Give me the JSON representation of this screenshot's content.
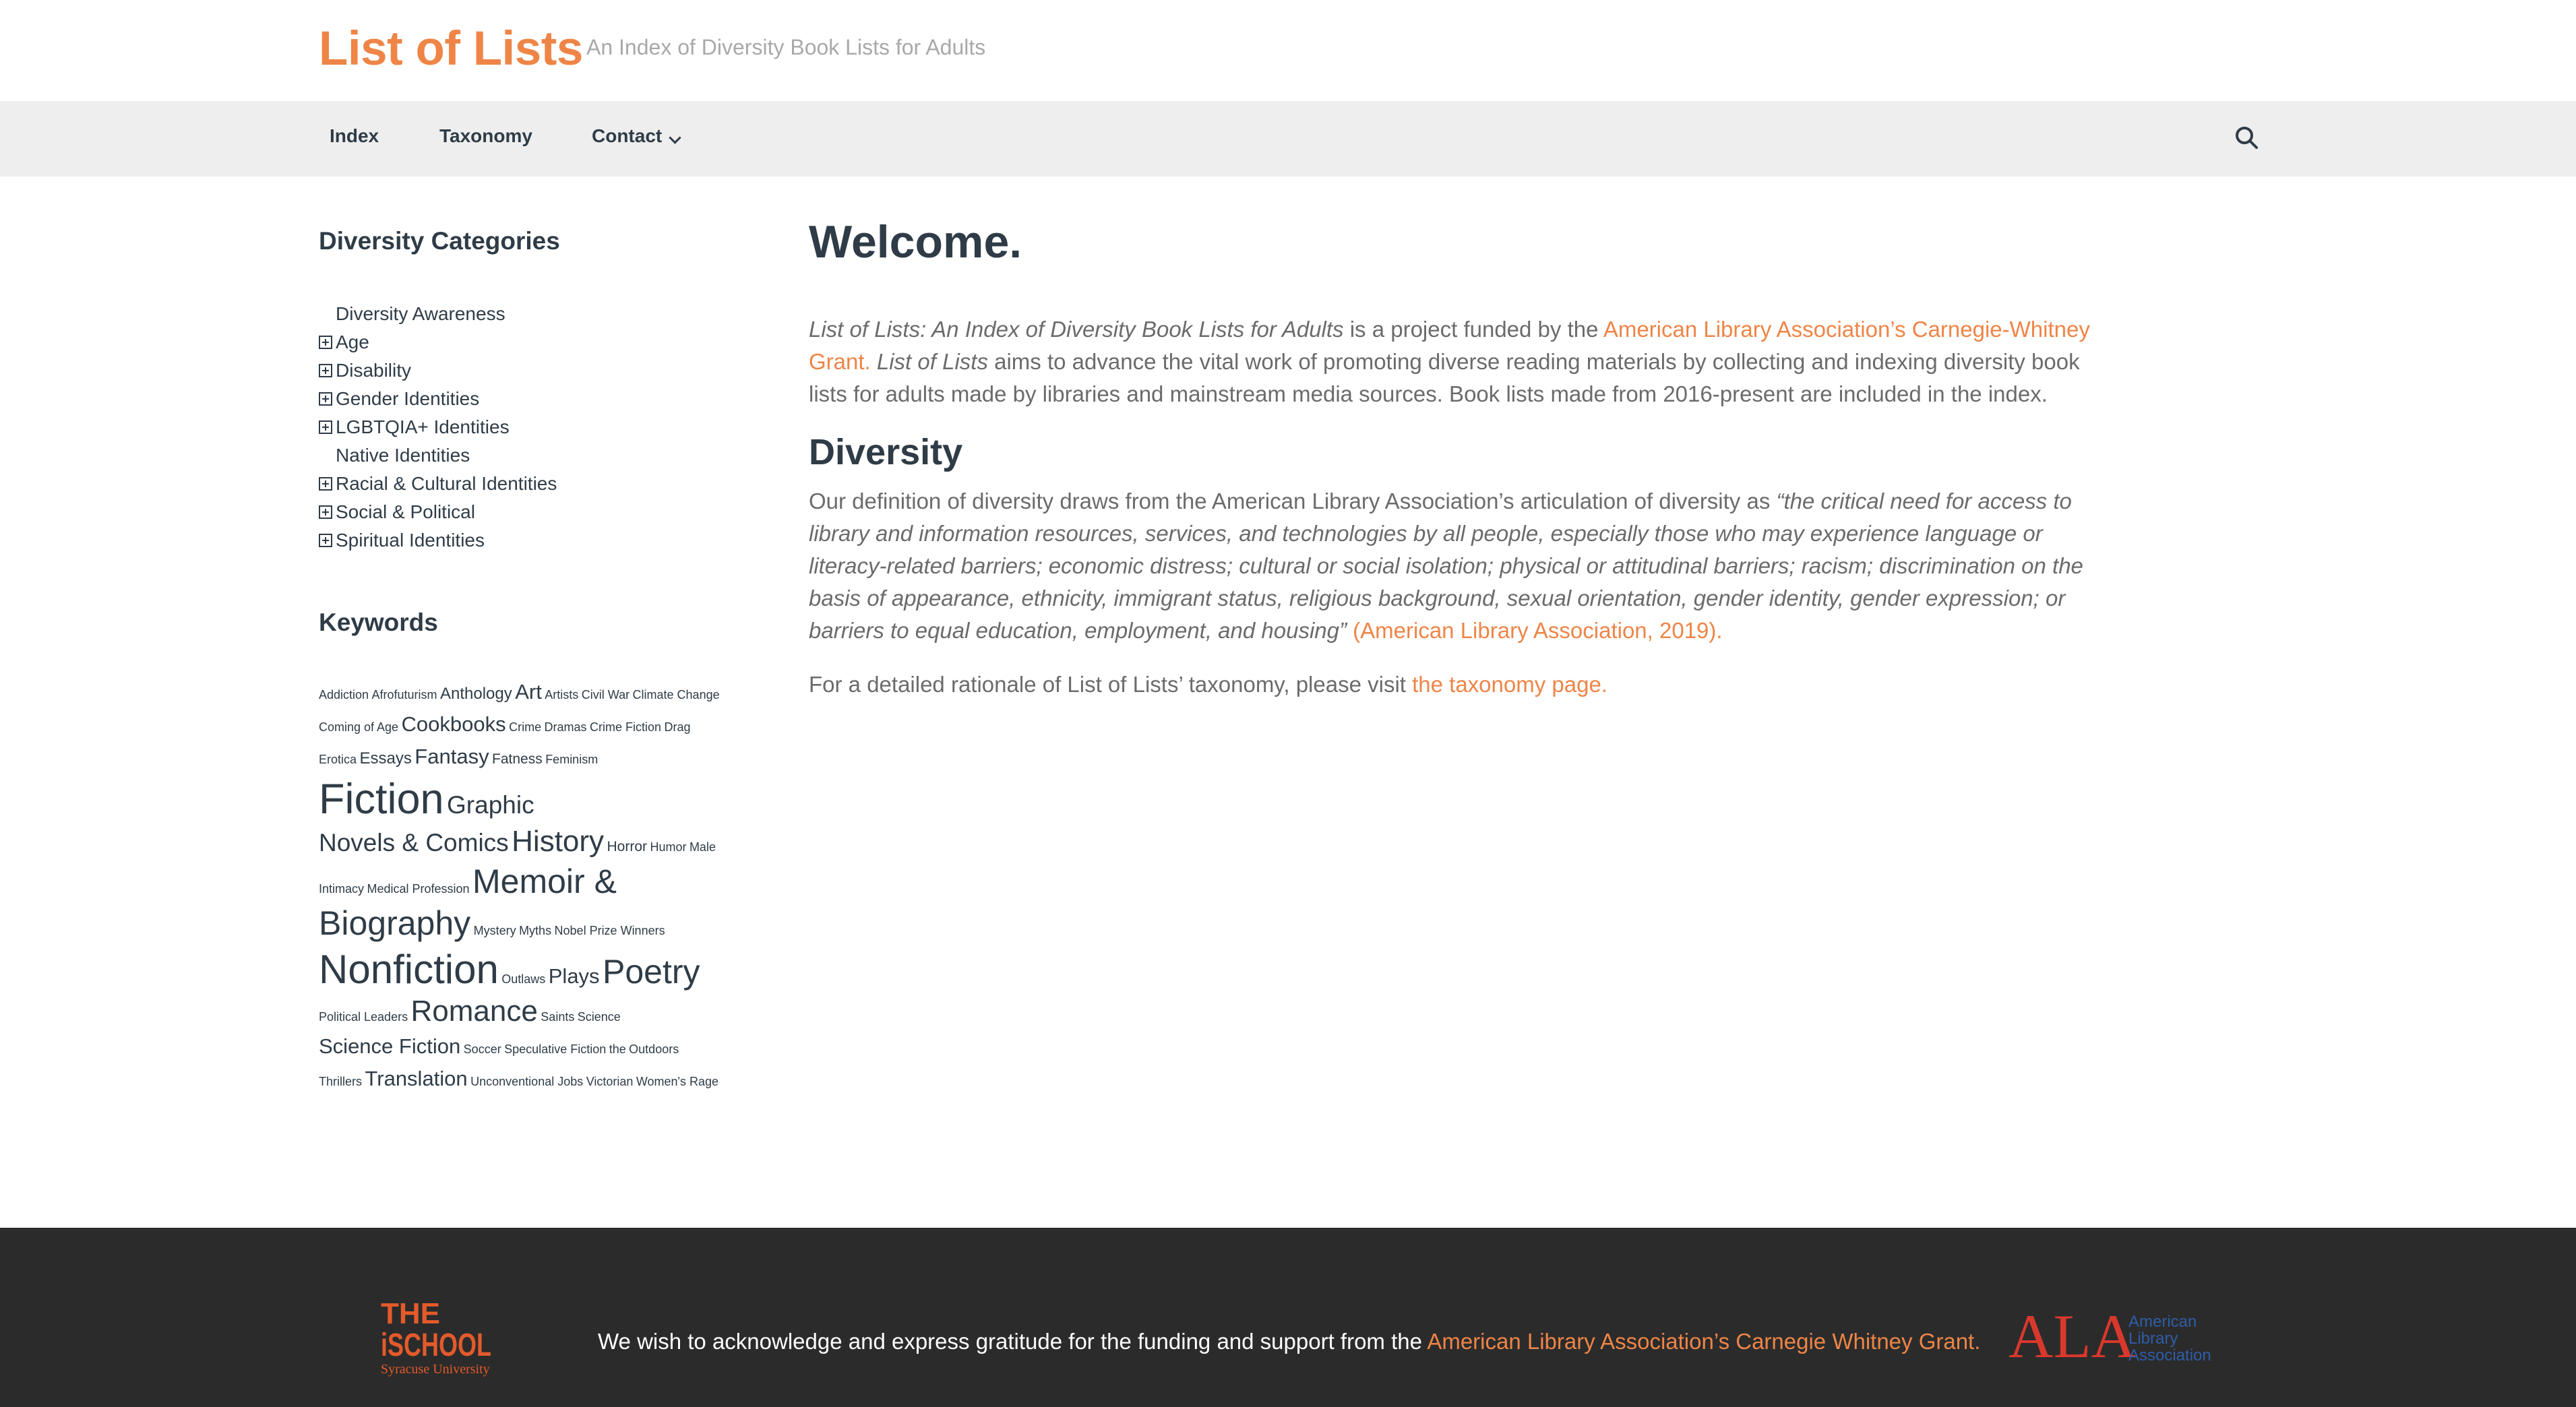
{
  "header": {
    "title": "List of Lists",
    "tagline": "An Index of Diversity Book Lists for Adults"
  },
  "nav": {
    "items": [
      {
        "label": "Index"
      },
      {
        "label": "Taxonomy"
      },
      {
        "label": "Contact"
      }
    ],
    "search_icon": "search-icon"
  },
  "sidebar": {
    "categories_title": "Diversity Categories",
    "categories": [
      {
        "label": "Diversity Awareness",
        "expandable": false
      },
      {
        "label": "Age",
        "expandable": true
      },
      {
        "label": "Disability",
        "expandable": true
      },
      {
        "label": "Gender Identities",
        "expandable": true
      },
      {
        "label": "LGBTQIA+ Identities",
        "expandable": true
      },
      {
        "label": "Native Identities",
        "expandable": false
      },
      {
        "label": "Racial & Cultural Identities",
        "expandable": true
      },
      {
        "label": "Social & Political",
        "expandable": true
      },
      {
        "label": "Spiritual Identities",
        "expandable": true
      }
    ],
    "keywords_title": "Keywords",
    "keywords": [
      {
        "label": "Addiction",
        "weight": 1
      },
      {
        "label": "Afrofuturism",
        "weight": 1
      },
      {
        "label": "Anthology",
        "weight": 2
      },
      {
        "label": "Art",
        "weight": 3
      },
      {
        "label": "Artists",
        "weight": 1
      },
      {
        "label": "Civil War",
        "weight": 1
      },
      {
        "label": "Climate Change",
        "weight": 1
      },
      {
        "label": "Coming of Age",
        "weight": 1
      },
      {
        "label": "Cookbooks",
        "weight": 3
      },
      {
        "label": "Crime",
        "weight": 1
      },
      {
        "label": "Dramas",
        "weight": 1
      },
      {
        "label": "Crime Fiction",
        "weight": 1
      },
      {
        "label": "Drag",
        "weight": 1
      },
      {
        "label": "Erotica",
        "weight": 1
      },
      {
        "label": "Essays",
        "weight": 2
      },
      {
        "label": "Fantasy",
        "weight": 3
      },
      {
        "label": "Fatness",
        "weight": 1.5
      },
      {
        "label": "Feminism",
        "weight": 1
      },
      {
        "label": "Fiction",
        "weight": 8
      },
      {
        "label": "Graphic",
        "weight": 4
      },
      {
        "label": "Novels & Comics",
        "weight": 4
      },
      {
        "label": "History",
        "weight": 5
      },
      {
        "label": "Horror",
        "weight": 1.5
      },
      {
        "label": "Humor",
        "weight": 1
      },
      {
        "label": "Male",
        "weight": 1
      },
      {
        "label": "Intimacy",
        "weight": 1
      },
      {
        "label": "Medical Profession",
        "weight": 1
      },
      {
        "label": "Memoir &",
        "weight": 6
      },
      {
        "label": "Biography",
        "weight": 6
      },
      {
        "label": "Mystery",
        "weight": 1
      },
      {
        "label": "Myths",
        "weight": 1
      },
      {
        "label": "Nobel Prize Winners",
        "weight": 1
      },
      {
        "label": "Nonfiction",
        "weight": 7.5
      },
      {
        "label": "Outlaws",
        "weight": 1
      },
      {
        "label": "Plays",
        "weight": 3
      },
      {
        "label": "Poetry",
        "weight": 6
      },
      {
        "label": "Political Leaders",
        "weight": 1
      },
      {
        "label": "Romance",
        "weight": 5
      },
      {
        "label": "Saints",
        "weight": 1
      },
      {
        "label": "Science",
        "weight": 1
      },
      {
        "label": "Science Fiction",
        "weight": 3
      },
      {
        "label": "Soccer",
        "weight": 1
      },
      {
        "label": "Speculative Fiction",
        "weight": 1
      },
      {
        "label": "the",
        "weight": 1
      },
      {
        "label": "Outdoors",
        "weight": 1
      },
      {
        "label": "Thrillers",
        "weight": 1
      },
      {
        "label": "Translation",
        "weight": 3
      },
      {
        "label": "Unconventional Jobs",
        "weight": 1
      },
      {
        "label": "Victorian",
        "weight": 1
      },
      {
        "label": "Women's Rage",
        "weight": 1
      }
    ]
  },
  "main": {
    "welcome_heading": "Welcome.",
    "intro": {
      "italic_title": "List of Lists: An Index of Diversity Book Lists for Adults",
      "text_1": " is a project funded by the ",
      "grant_link": "American Library Association’s Carnegie-Whitney Grant.",
      "italic_short": "List of Lists",
      "text_2": " aims to advance the vital work of promoting diverse reading materials by collecting and indexing diversity book lists for adults made by libraries and mainstream media sources. Book lists made from 2016-present are included in the index."
    },
    "diversity_heading": "Diversity",
    "definition": {
      "text": "Our definition of diversity draws from the American Library Association’s articulation of diversity as ",
      "quote": "“the critical need for access to library and information resources, services, and technologies by all people, especially those who may experience language or literacy-related barriers; economic distress; cultural or social isolation; physical or attitudinal barriers; racism; discrimination on the basis of appearance, ethnicity, immigrant status, religious background, sexual orientation, gender identity, gender expression; or barriers to equal education, employment, and housing”",
      "citation": "(American Library Association, 2019)."
    },
    "rationale": {
      "text": "For a detailed rationale of List of Lists’ taxonomy, please visit ",
      "link": "the taxonomy page."
    }
  },
  "footer": {
    "text": "We wish to acknowledge and express gratitude for the funding and support from the ",
    "link": "American Library Association’s Carnegie Whitney Grant.",
    "ischool_logo": {
      "line1": "THE",
      "line2": "iSCHOOL",
      "line3": "Syracuse University"
    },
    "ala_logo": {
      "letters": "ALA",
      "line1": "American",
      "line2": "Library",
      "line3": "Association"
    }
  },
  "colors": {
    "accent": "#ee8547",
    "heading": "#2f3c47",
    "body_text": "#6b6b6b",
    "nav_bg": "#eeeeee",
    "footer_bg": "#2b2b2b",
    "ischool_orange": "#e35a2b",
    "ala_red": "#d9382d",
    "ala_blue": "#2f5da8"
  }
}
